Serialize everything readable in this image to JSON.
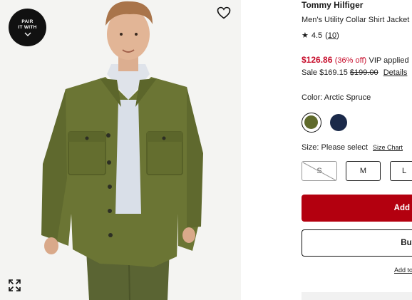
{
  "media": {
    "pair_badge": {
      "line1": "PAIR",
      "line2": "IT WITH"
    },
    "icons": {
      "wishlist": "heart-outline-icon",
      "expand": "expand-arrows-icon",
      "badge_chevron": "chevron-down-icon"
    }
  },
  "product": {
    "brand": "Tommy Hilfiger",
    "name": "Men's Utility Collar Shirt Jacket",
    "rating": {
      "star": "★",
      "value": "4.5",
      "count": "10"
    },
    "price": {
      "current": "$126.86",
      "discount": "(36% off)",
      "vip": "VIP applied"
    },
    "sale": {
      "label": "Sale $169.15",
      "original": "$199.00",
      "details_link": "Details"
    },
    "color": {
      "label": "Color: Arctic Spruce",
      "swatches": [
        {
          "name": "Arctic Spruce",
          "hex": "#5f6a2b",
          "selected": true
        },
        {
          "name": "Navy",
          "hex": "#1b2a4a",
          "selected": false
        }
      ]
    },
    "size": {
      "label": "Size: Please select",
      "chart_link": "Size Chart",
      "options": [
        {
          "label": "S",
          "available": false
        },
        {
          "label": "M",
          "available": true
        },
        {
          "label": "L",
          "available": true
        }
      ]
    },
    "actions": {
      "add": "Add",
      "buy": "Buy",
      "add_to": "Add to"
    }
  },
  "colors": {
    "accent_red": "#c8102e",
    "button_red": "#b3000f"
  }
}
